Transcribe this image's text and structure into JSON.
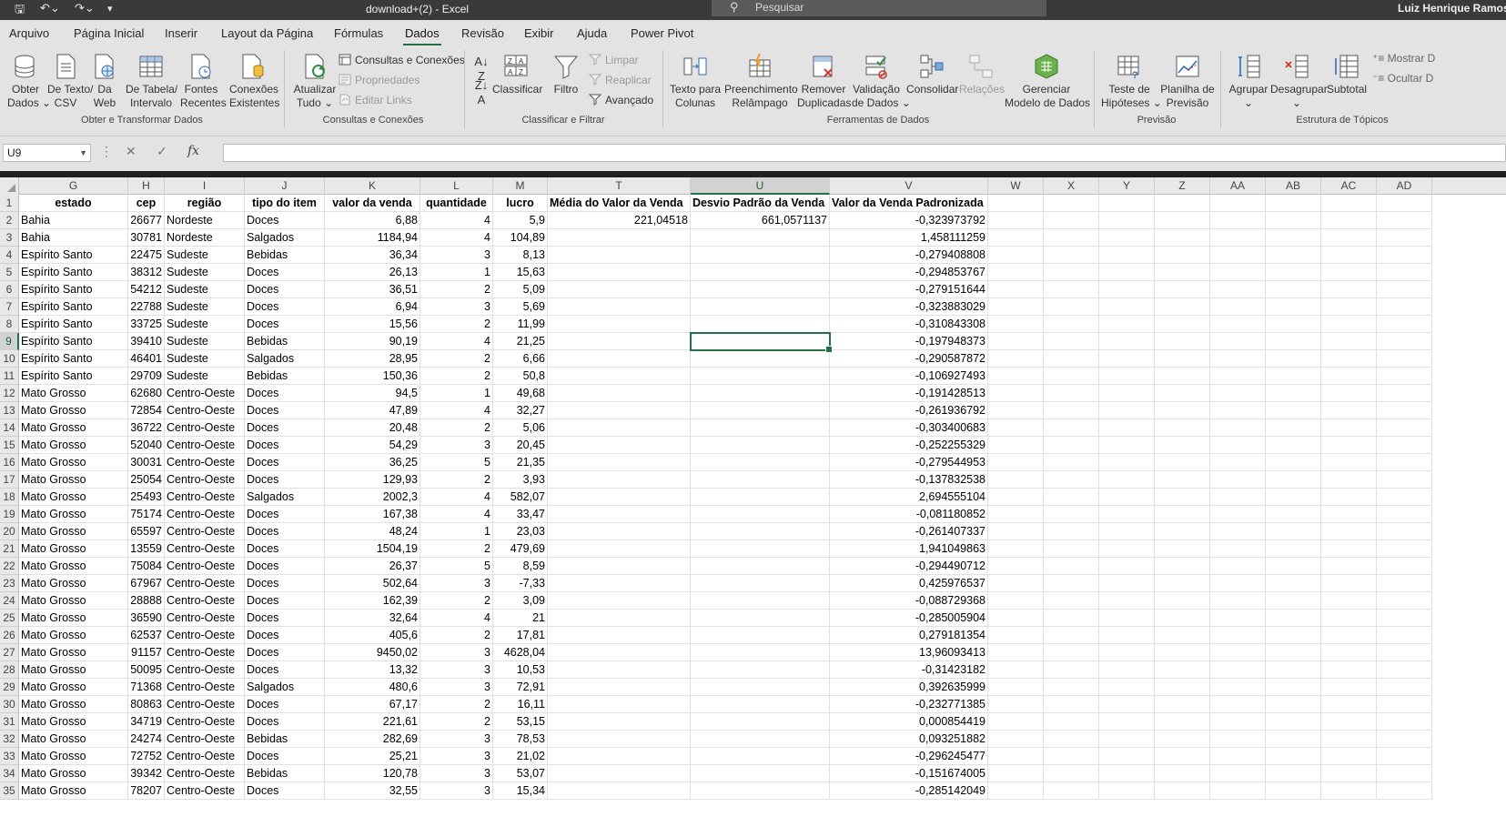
{
  "titlebar": {
    "doc_title": "download+(2)  -  Excel",
    "search_placeholder": "Pesquisar",
    "user_name": "Luiz Henrique Ramos P"
  },
  "menu_tabs": [
    "Arquivo",
    "Página Inicial",
    "Inserir",
    "Layout da Página",
    "Fórmulas",
    "Dados",
    "Revisão",
    "Exibir",
    "Ajuda",
    "Power Pivot"
  ],
  "active_tab": "Dados",
  "ribbon": {
    "groups": {
      "get_transform": "Obter e Transformar Dados",
      "queries": "Consultas e Conexões",
      "sort_filter": "Classificar e Filtrar",
      "data_tools": "Ferramentas de Dados",
      "forecast": "Previsão",
      "outline": "Estrutura de Tópicos"
    },
    "buttons": {
      "obter_dados": [
        "Obter",
        "Dados ⌄"
      ],
      "de_texto": [
        "De Texto/",
        "CSV"
      ],
      "da_web": [
        "Da",
        "Web"
      ],
      "de_tabela": [
        "De Tabela/",
        "Intervalo"
      ],
      "fontes_recentes": [
        "Fontes",
        "Recentes"
      ],
      "conexoes_existentes": [
        "Conexões",
        "Existentes"
      ],
      "atualizar_tudo": [
        "Atualizar",
        "Tudo ⌄"
      ],
      "consultas_conexoes": "Consultas e Conexões",
      "propriedades": "Propriedades",
      "editar_links": "Editar Links",
      "classificar": "Classificar",
      "filtro": "Filtro",
      "limpar": "Limpar",
      "reaplicar": "Reaplicar",
      "avancado": "Avançado",
      "texto_colunas": [
        "Texto para",
        "Colunas"
      ],
      "preenchimento": [
        "Preenchimento",
        "Relâmpago"
      ],
      "remover_duplicadas": [
        "Remover",
        "Duplicadas"
      ],
      "validacao": [
        "Validação",
        "de Dados ⌄"
      ],
      "consolidar": "Consolidar",
      "relacoes": "Relações",
      "gerenciar_modelo": [
        "Gerenciar",
        "Modelo de Dados"
      ],
      "teste_hipoteses": [
        "Teste de",
        "Hipóteses ⌄"
      ],
      "planilha_previsao": [
        "Planilha de",
        "Previsão"
      ],
      "agrupar": [
        "Agrupar",
        "⌄"
      ],
      "desagrupar": [
        "Desagrupar",
        "⌄"
      ],
      "subtotal": "Subtotal",
      "mostrar": "Mostrar D",
      "ocultar": "Ocultar D"
    }
  },
  "formula_bar": {
    "name_box": "U9",
    "cancel": "✕",
    "enter": "✓",
    "fx": "fx",
    "formula": ""
  },
  "columns": [
    {
      "id": "G",
      "w": 120
    },
    {
      "id": "H",
      "w": 40
    },
    {
      "id": "I",
      "w": 88
    },
    {
      "id": "J",
      "w": 88
    },
    {
      "id": "K",
      "w": 105
    },
    {
      "id": "L",
      "w": 80
    },
    {
      "id": "M",
      "w": 60
    },
    {
      "id": "T",
      "w": 157
    },
    {
      "id": "U",
      "w": 153
    },
    {
      "id": "V",
      "w": 174
    },
    {
      "id": "W",
      "w": 61
    },
    {
      "id": "X",
      "w": 61
    },
    {
      "id": "Y",
      "w": 61
    },
    {
      "id": "Z",
      "w": 61
    },
    {
      "id": "AA",
      "w": 61
    },
    {
      "id": "AB",
      "w": 61
    },
    {
      "id": "AC",
      "w": 61
    },
    {
      "id": "AD",
      "w": 61
    }
  ],
  "selected_cell": {
    "col": "U",
    "row": "9"
  },
  "header_row": [
    "estado",
    "cep",
    "região",
    "tipo do item",
    "valor da venda",
    "quantidade",
    "lucro",
    "Média do Valor da Venda",
    "Desvio  Padrão da Venda",
    "Valor da Venda Padronizada"
  ],
  "rows": [
    [
      "2",
      "Bahia",
      "26677",
      "Nordeste",
      "Doces",
      "6,88",
      "4",
      "5,9",
      "221,04518",
      "661,0571137",
      "-0,323973792"
    ],
    [
      "3",
      "Bahia",
      "30781",
      "Nordeste",
      "Salgados",
      "1184,94",
      "4",
      "104,89",
      "",
      "",
      "1,458111259"
    ],
    [
      "4",
      "Espírito Santo",
      "22475",
      "Sudeste",
      "Bebidas",
      "36,34",
      "3",
      "8,13",
      "",
      "",
      "-0,279408808"
    ],
    [
      "5",
      "Espírito Santo",
      "38312",
      "Sudeste",
      "Doces",
      "26,13",
      "1",
      "15,63",
      "",
      "",
      "-0,294853767"
    ],
    [
      "6",
      "Espírito Santo",
      "54212",
      "Sudeste",
      "Doces",
      "36,51",
      "2",
      "5,09",
      "",
      "",
      "-0,279151644"
    ],
    [
      "7",
      "Espírito Santo",
      "22788",
      "Sudeste",
      "Doces",
      "6,94",
      "3",
      "5,69",
      "",
      "",
      "-0,323883029"
    ],
    [
      "8",
      "Espírito Santo",
      "33725",
      "Sudeste",
      "Doces",
      "15,56",
      "2",
      "11,99",
      "",
      "",
      "-0,310843308"
    ],
    [
      "9",
      "Espírito Santo",
      "39410",
      "Sudeste",
      "Bebidas",
      "90,19",
      "4",
      "21,25",
      "",
      "",
      "-0,197948373"
    ],
    [
      "10",
      "Espírito Santo",
      "46401",
      "Sudeste",
      "Salgados",
      "28,95",
      "2",
      "6,66",
      "",
      "",
      "-0,290587872"
    ],
    [
      "11",
      "Espírito Santo",
      "29709",
      "Sudeste",
      "Bebidas",
      "150,36",
      "2",
      "50,8",
      "",
      "",
      "-0,106927493"
    ],
    [
      "12",
      "Mato Grosso",
      "62680",
      "Centro-Oeste",
      "Doces",
      "94,5",
      "1",
      "49,68",
      "",
      "",
      "-0,191428513"
    ],
    [
      "13",
      "Mato Grosso",
      "72854",
      "Centro-Oeste",
      "Doces",
      "47,89",
      "4",
      "32,27",
      "",
      "",
      "-0,261936792"
    ],
    [
      "14",
      "Mato Grosso",
      "36722",
      "Centro-Oeste",
      "Doces",
      "20,48",
      "2",
      "5,06",
      "",
      "",
      "-0,303400683"
    ],
    [
      "15",
      "Mato Grosso",
      "52040",
      "Centro-Oeste",
      "Doces",
      "54,29",
      "3",
      "20,45",
      "",
      "",
      "-0,252255329"
    ],
    [
      "16",
      "Mato Grosso",
      "30031",
      "Centro-Oeste",
      "Doces",
      "36,25",
      "5",
      "21,35",
      "",
      "",
      "-0,279544953"
    ],
    [
      "17",
      "Mato Grosso",
      "25054",
      "Centro-Oeste",
      "Doces",
      "129,93",
      "2",
      "3,93",
      "",
      "",
      "-0,137832538"
    ],
    [
      "18",
      "Mato Grosso",
      "25493",
      "Centro-Oeste",
      "Salgados",
      "2002,3",
      "4",
      "582,07",
      "",
      "",
      "2,694555104"
    ],
    [
      "19",
      "Mato Grosso",
      "75174",
      "Centro-Oeste",
      "Doces",
      "167,38",
      "4",
      "33,47",
      "",
      "",
      "-0,081180852"
    ],
    [
      "20",
      "Mato Grosso",
      "65597",
      "Centro-Oeste",
      "Doces",
      "48,24",
      "1",
      "23,03",
      "",
      "",
      "-0,261407337"
    ],
    [
      "21",
      "Mato Grosso",
      "13559",
      "Centro-Oeste",
      "Doces",
      "1504,19",
      "2",
      "479,69",
      "",
      "",
      "1,941049863"
    ],
    [
      "22",
      "Mato Grosso",
      "75084",
      "Centro-Oeste",
      "Doces",
      "26,37",
      "5",
      "8,59",
      "",
      "",
      "-0,294490712"
    ],
    [
      "23",
      "Mato Grosso",
      "67967",
      "Centro-Oeste",
      "Doces",
      "502,64",
      "3",
      "-7,33",
      "",
      "",
      "0,425976537"
    ],
    [
      "24",
      "Mato Grosso",
      "28888",
      "Centro-Oeste",
      "Doces",
      "162,39",
      "2",
      "3,09",
      "",
      "",
      "-0,088729368"
    ],
    [
      "25",
      "Mato Grosso",
      "36590",
      "Centro-Oeste",
      "Doces",
      "32,64",
      "4",
      "21",
      "",
      "",
      "-0,285005904"
    ],
    [
      "26",
      "Mato Grosso",
      "62537",
      "Centro-Oeste",
      "Doces",
      "405,6",
      "2",
      "17,81",
      "",
      "",
      "0,279181354"
    ],
    [
      "27",
      "Mato Grosso",
      "91157",
      "Centro-Oeste",
      "Doces",
      "9450,02",
      "3",
      "4628,04",
      "",
      "",
      "13,96093413"
    ],
    [
      "28",
      "Mato Grosso",
      "50095",
      "Centro-Oeste",
      "Doces",
      "13,32",
      "3",
      "10,53",
      "",
      "",
      "-0,31423182"
    ],
    [
      "29",
      "Mato Grosso",
      "71368",
      "Centro-Oeste",
      "Salgados",
      "480,6",
      "3",
      "72,91",
      "",
      "",
      "0,392635999"
    ],
    [
      "30",
      "Mato Grosso",
      "80863",
      "Centro-Oeste",
      "Doces",
      "67,17",
      "2",
      "16,11",
      "",
      "",
      "-0,232771385"
    ],
    [
      "31",
      "Mato Grosso",
      "34719",
      "Centro-Oeste",
      "Doces",
      "221,61",
      "2",
      "53,15",
      "",
      "",
      "0,000854419"
    ],
    [
      "32",
      "Mato Grosso",
      "24274",
      "Centro-Oeste",
      "Bebidas",
      "282,69",
      "3",
      "78,53",
      "",
      "",
      "0,093251882"
    ],
    [
      "33",
      "Mato Grosso",
      "72752",
      "Centro-Oeste",
      "Doces",
      "25,21",
      "3",
      "21,02",
      "",
      "",
      "-0,296245477"
    ],
    [
      "34",
      "Mato Grosso",
      "39342",
      "Centro-Oeste",
      "Bebidas",
      "120,78",
      "3",
      "53,07",
      "",
      "",
      "-0,151674005"
    ],
    [
      "35",
      "Mato Grosso",
      "78207",
      "Centro-Oeste",
      "Doces",
      "32,55",
      "3",
      "15,34",
      "",
      "",
      "-0,285142049"
    ]
  ],
  "colors": {
    "accent": "#217346",
    "title_bar": "#3a3a3a",
    "ribbon": "#e3e3e3"
  }
}
